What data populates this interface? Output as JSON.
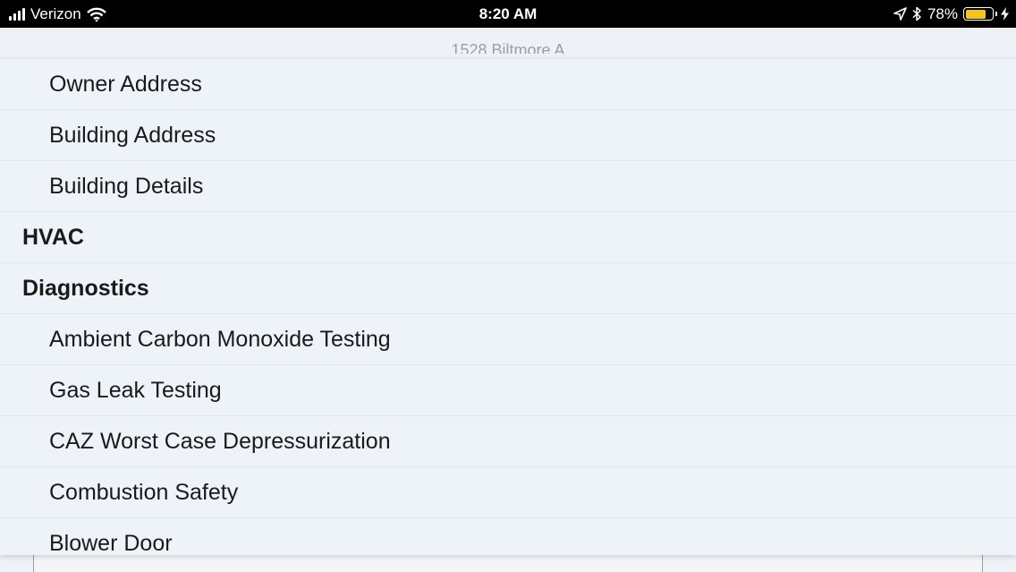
{
  "status_bar": {
    "carrier": "Verizon",
    "time": "8:20 AM",
    "battery_percent": "78%",
    "battery_level": 0.78,
    "icons": [
      "signal-icon",
      "wifi-icon",
      "location-icon",
      "bluetooth-icon",
      "battery-icon",
      "charging-icon"
    ]
  },
  "background": {
    "title_partial": "1528 Biltmore A"
  },
  "menu": {
    "items": [
      {
        "label": "Owner Address",
        "type": "child"
      },
      {
        "label": "Building Address",
        "type": "child"
      },
      {
        "label": "Building Details",
        "type": "child"
      },
      {
        "label": "HVAC",
        "type": "header"
      },
      {
        "label": "Diagnostics",
        "type": "header"
      },
      {
        "label": "Ambient Carbon Monoxide Testing",
        "type": "child"
      },
      {
        "label": "Gas Leak Testing",
        "type": "child"
      },
      {
        "label": "CAZ Worst Case Depressurization",
        "type": "child"
      },
      {
        "label": "Combustion Safety",
        "type": "child"
      },
      {
        "label": "Blower Door",
        "type": "child"
      }
    ]
  }
}
